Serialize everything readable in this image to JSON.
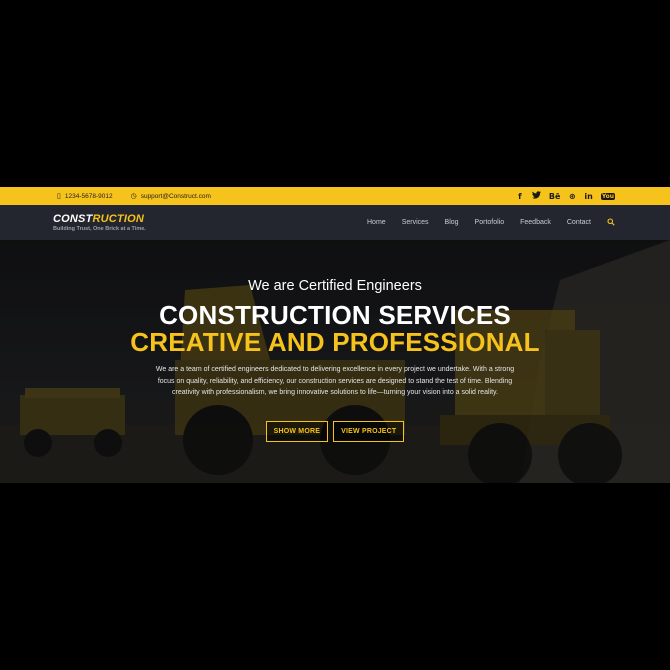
{
  "topbar": {
    "phone": "1234-5678-9012",
    "email": "support@Construct.com",
    "socials": [
      {
        "icon": "facebook-icon",
        "glyph": "f"
      },
      {
        "icon": "twitter-icon",
        "glyph": "🐦"
      },
      {
        "icon": "behance-icon",
        "glyph": "Bē"
      },
      {
        "icon": "dribbble-icon",
        "glyph": "⊛"
      },
      {
        "icon": "linkedin-icon",
        "glyph": "in"
      },
      {
        "icon": "youtube-icon",
        "glyph": "You"
      }
    ]
  },
  "brand": {
    "name_part1": "CONST",
    "name_part2": "RUCTION",
    "tagline": "Building Trust, One Brick at a Time."
  },
  "nav": {
    "items": [
      "Home",
      "Services",
      "Blog",
      "Portofolio",
      "Feedback",
      "Contact"
    ],
    "search_icon": "search-icon"
  },
  "hero": {
    "eyebrow": "We are Certified Engineers",
    "title_line1": "CONSTRUCTION SERVICES",
    "title_line2": "CREATIVE AND PROFESSIONAL",
    "description": "We are a team of certified engineers dedicated to delivering excellence in every project we undertake. With a strong focus on quality, reliability, and efficiency, our construction services are designed to stand the test of time. Blending creativity with professionalism, we bring innovative solutions to life—turning your vision into a solid reality.",
    "buttons": [
      "SHOW MORE",
      "VIEW PROJECT"
    ]
  },
  "colors": {
    "accent": "#f6c21c",
    "nav_bg": "#23262e",
    "page_bg": "#000000"
  }
}
